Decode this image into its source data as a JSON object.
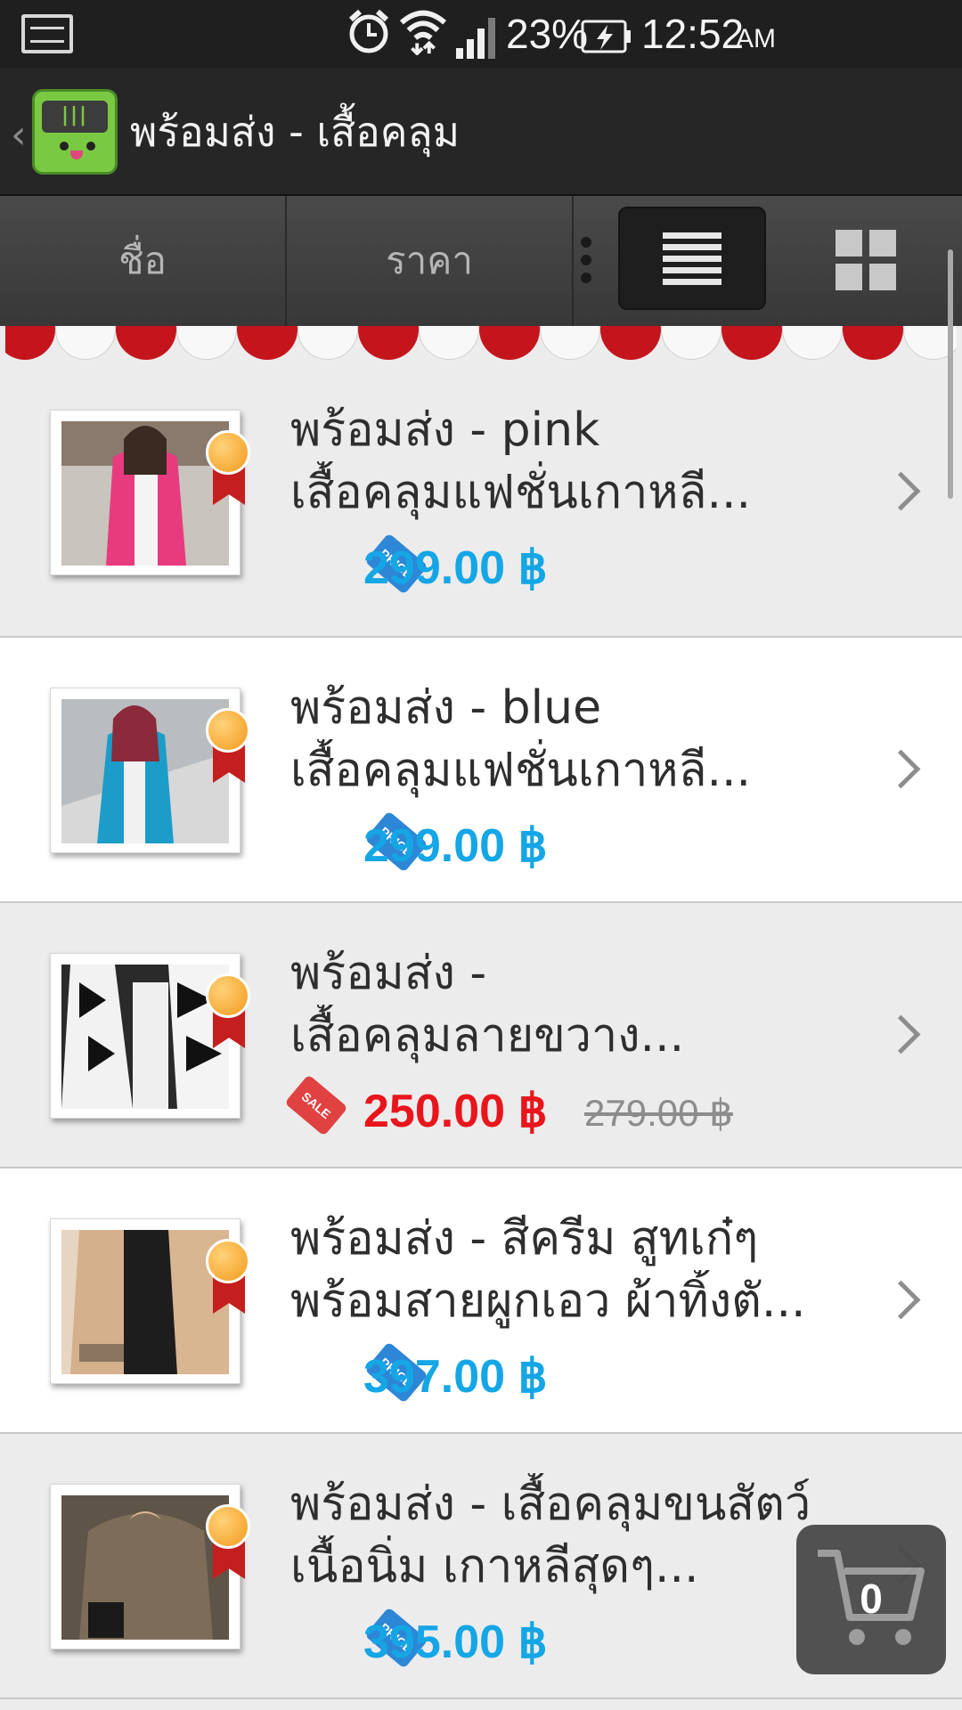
{
  "status_bar": {
    "battery": "23%",
    "time": "12:52",
    "ampm": "AM"
  },
  "header": {
    "back": "‹",
    "title": "พร้อมส่ง - เสื้อคลุม"
  },
  "sort_bar": {
    "sort_name": "ชื่อ",
    "sort_price": "ราคา"
  },
  "products": [
    {
      "name_line1": "พร้อมส่ง - pink",
      "name_line2": "เสื้อคลุมแฟชั่นเกาหลี...",
      "tag": "PRICE",
      "price": "299.00 ฿",
      "old_price": ""
    },
    {
      "name_line1": "พร้อมส่ง - blue",
      "name_line2": "เสื้อคลุมแฟชั่นเกาหลี...",
      "tag": "PRICE",
      "price": "299.00 ฿",
      "old_price": ""
    },
    {
      "name_line1": "พร้อมส่ง -",
      "name_line2": "เสื้อคลุมลายขวาง...",
      "tag": "SALE",
      "price": "250.00 ฿",
      "old_price": "279.00 ฿"
    },
    {
      "name_line1": "พร้อมส่ง - สีครีม สูทเก๋ๆ",
      "name_line2": "พร้อมสายผูกเอว ผ้าทิ้งตั...",
      "tag": "PRICE",
      "price": "397.00 ฿",
      "old_price": ""
    },
    {
      "name_line1": "พร้อมส่ง - เสื้อคลุมขนสัตว์",
      "name_line2": "เนื้อนิ่ม เกาหลีสุดๆ...",
      "tag": "PRICE",
      "price": "395.00 ฿",
      "old_price": ""
    }
  ],
  "cart": {
    "count": "0"
  },
  "colors": {
    "price_blue": "#15a6e5",
    "sale_red": "#e8161c",
    "awning_red": "#c4151d"
  }
}
